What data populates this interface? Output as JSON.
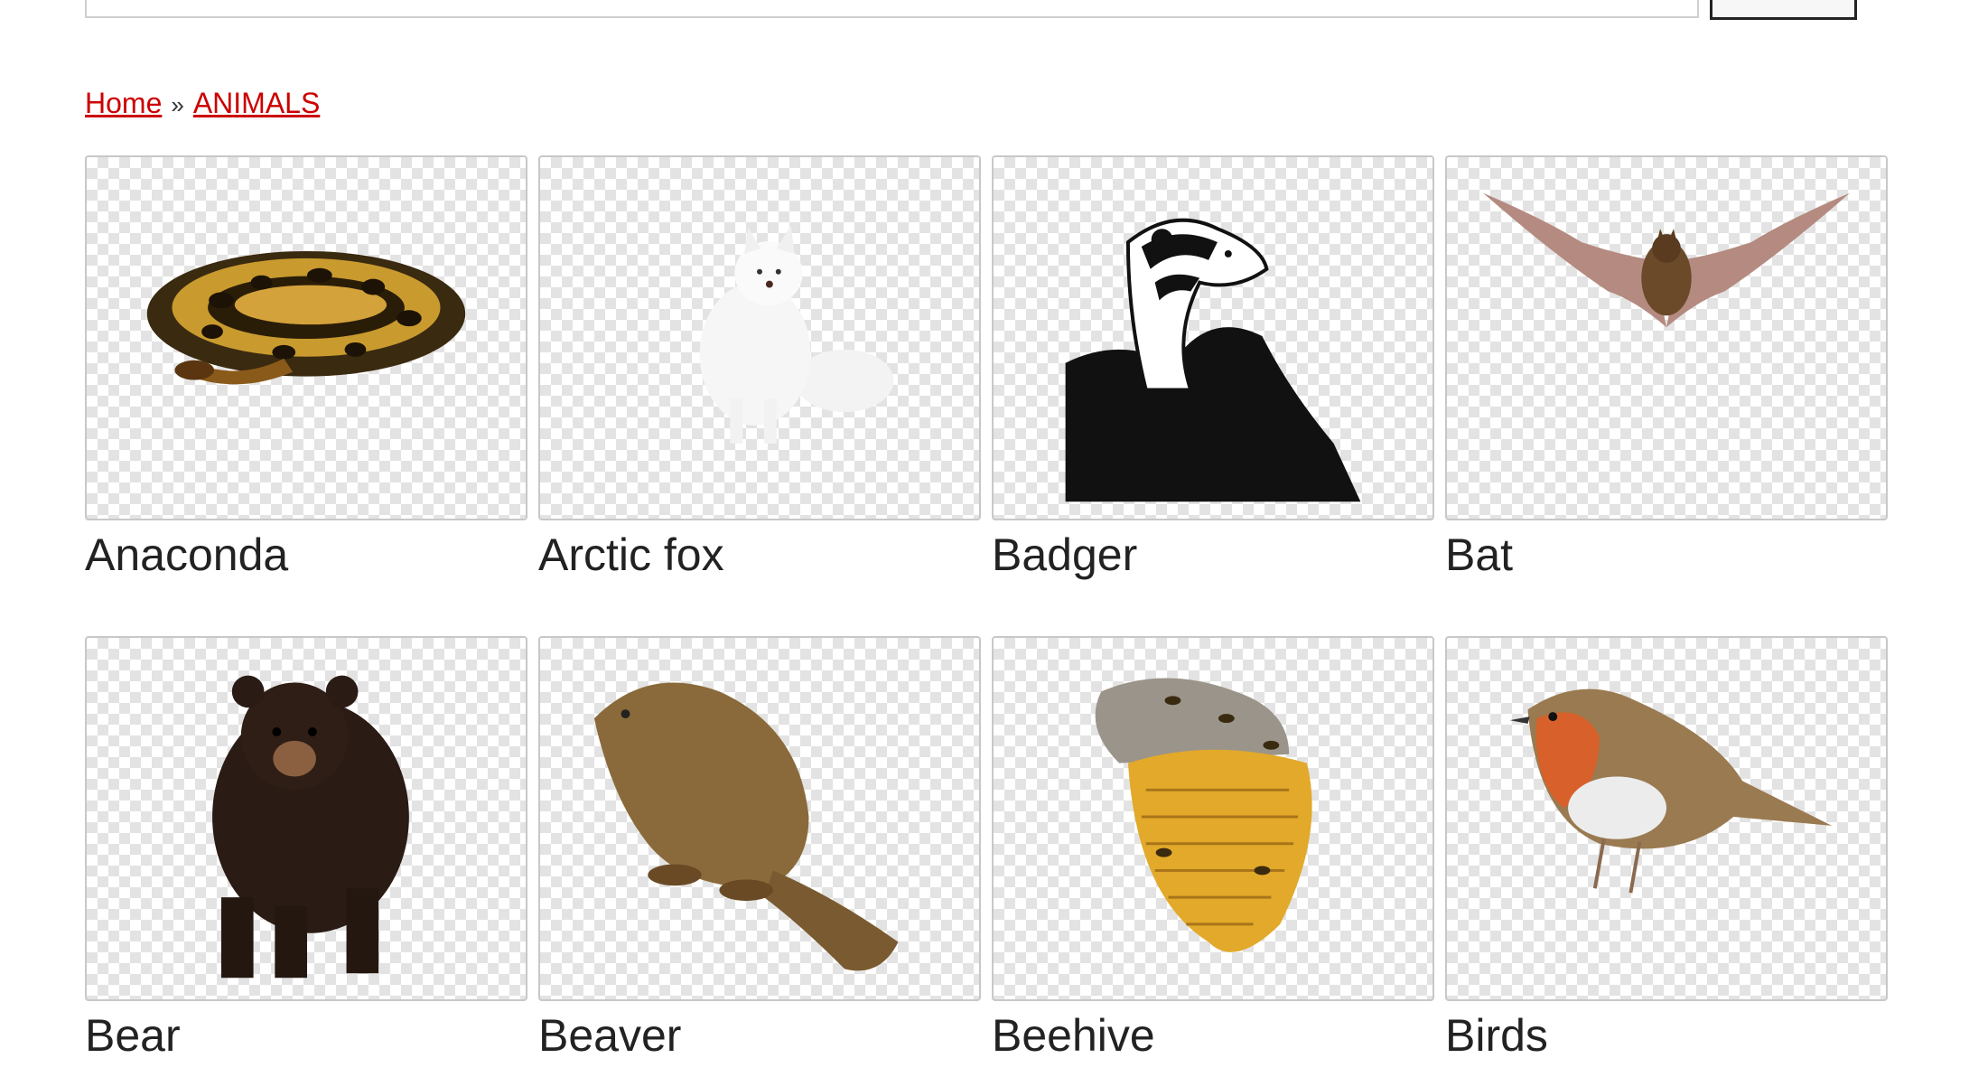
{
  "breadcrumb": {
    "home": "Home",
    "separator": "»",
    "current": "ANIMALS"
  },
  "items": [
    {
      "label": "Anaconda",
      "icon": "anaconda-image"
    },
    {
      "label": "Arctic fox",
      "icon": "arctic-fox-image"
    },
    {
      "label": "Badger",
      "icon": "badger-image"
    },
    {
      "label": "Bat",
      "icon": "bat-image"
    },
    {
      "label": "Bear",
      "icon": "bear-image"
    },
    {
      "label": "Beaver",
      "icon": "beaver-image"
    },
    {
      "label": "Beehive",
      "icon": "beehive-image"
    },
    {
      "label": "Birds",
      "icon": "birds-image"
    }
  ],
  "colors": {
    "link": "#cc0000",
    "checker": "#e3e3e3",
    "border": "#c8c8c8"
  }
}
